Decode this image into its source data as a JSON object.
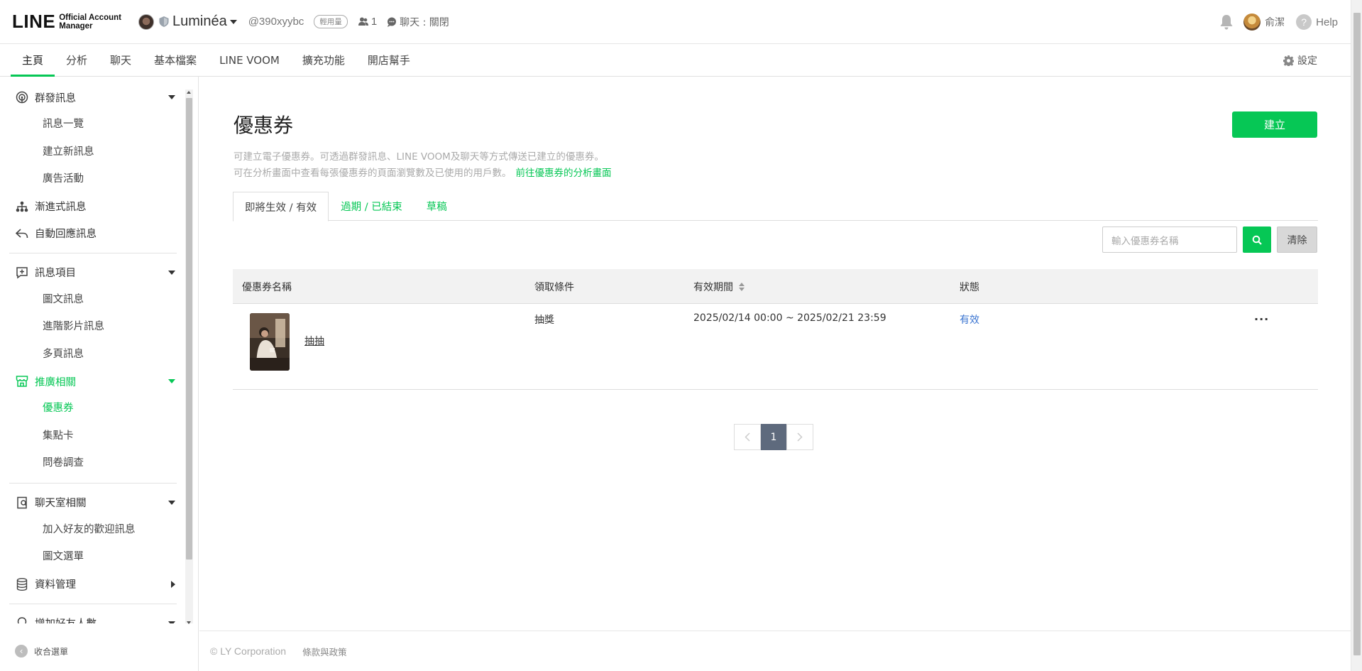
{
  "header": {
    "logo_main": "LINE",
    "logo_sub_1": "Official Account",
    "logo_sub_2": "Manager",
    "account_name": "Luminéa",
    "account_id": "@390xyybc",
    "plan_badge": "輕用量",
    "friends_count": "1",
    "chat_status": "聊天 : 關閉",
    "user_name": "俞潔",
    "help_label": "Help"
  },
  "nav": {
    "tabs": [
      "主頁",
      "分析",
      "聊天",
      "基本檔案",
      "LINE VOOM",
      "擴充功能",
      "開店幫手"
    ],
    "settings_label": "設定"
  },
  "sidebar": {
    "group_broadcast": "群發訊息",
    "broadcast_items": [
      "訊息一覽",
      "建立新訊息",
      "廣告活動"
    ],
    "step_messages": "漸進式訊息",
    "auto_reply": "自動回應訊息",
    "group_message_items": "訊息項目",
    "message_items": [
      "圖文訊息",
      "進階影片訊息",
      "多頁訊息"
    ],
    "group_promotion": "推廣相關",
    "promotion_items": [
      "優惠券",
      "集點卡",
      "問卷調查"
    ],
    "group_chatroom": "聊天室相關",
    "chatroom_items": [
      "加入好友的歡迎訊息",
      "圖文選單"
    ],
    "group_data": "資料管理",
    "group_friends": "增加好友人數",
    "collapse_label": "收合選單"
  },
  "main": {
    "title": "優惠券",
    "create_label": "建立",
    "desc_line1": "可建立電子優惠券。可透過群發訊息、LINE VOOM及聊天等方式傳送已建立的優惠券。",
    "desc_line2": "可在分析畫面中查看每張優惠券的頁面瀏覽數及已使用的用戶數。",
    "desc_link": "前往優惠券的分析畫面",
    "tabs": [
      "即將生效 / 有效",
      "過期 / 已結束",
      "草稿"
    ],
    "search_placeholder": "輸入優惠券名稱",
    "clear_label": "清除",
    "columns": [
      "優惠券名稱",
      "領取條件",
      "有效期間",
      "狀態"
    ],
    "rows": [
      {
        "name": "抽抽",
        "condition": "抽獎",
        "period": "2025/02/14 00:00 ~ 2025/02/21 23:59",
        "status": "有效",
        "more": "···"
      }
    ],
    "pagination": {
      "current": "1"
    }
  },
  "footer": {
    "copyright": "© LY Corporation",
    "terms": "條款與政策"
  },
  "colors": {
    "brand_green": "#06c755",
    "status_blue": "#3a74d1",
    "pagination_active": "#5e6a7d"
  }
}
